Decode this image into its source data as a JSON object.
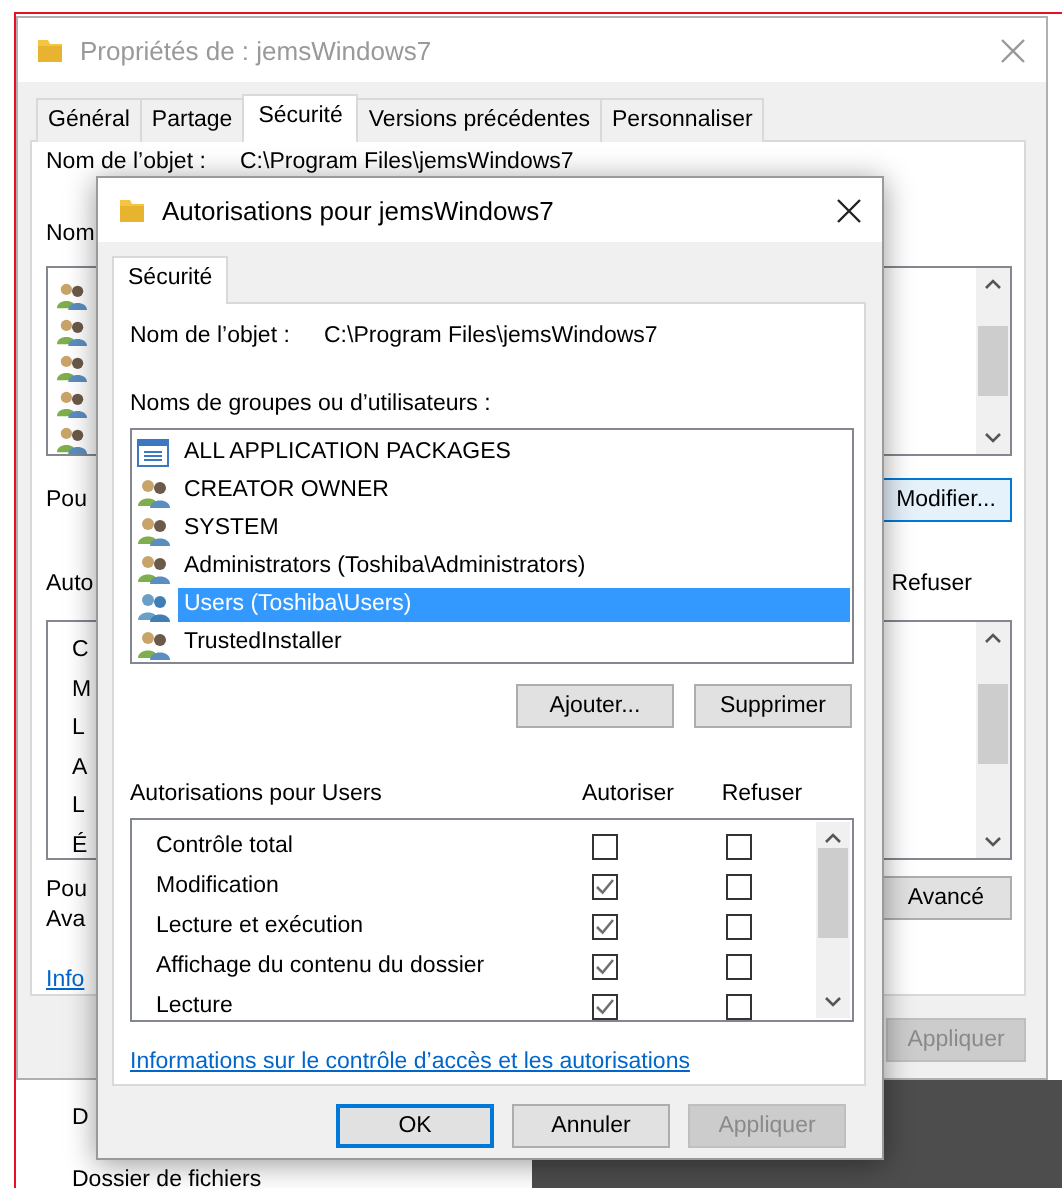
{
  "properties_window": {
    "title": "Propriétés de : jemsWindows7",
    "tabs": [
      {
        "label": "Général",
        "selected": false
      },
      {
        "label": "Partage",
        "selected": false
      },
      {
        "label": "Sécurité",
        "selected": true
      },
      {
        "label": "Versions précédentes",
        "selected": false
      },
      {
        "label": "Personnaliser",
        "selected": false
      }
    ],
    "object_label": "Nom de l’objet :",
    "object_path": "C:\\Program Files\\jemsWindows7",
    "groups_label": "Nom",
    "edit_note": "Pou",
    "modify_button": "Modifier...",
    "permissions_label": "Auto",
    "deny_header": "Refuser",
    "permission_fragments": [
      "C",
      "M",
      "L",
      "A",
      "L",
      "É"
    ],
    "advanced_note": [
      "Pou",
      "Ava"
    ],
    "advanced_button": "Avancé",
    "info_link": "Info",
    "apply_button": {
      "label": "Appliquer",
      "disabled": true
    }
  },
  "desktop_fragments": [
    "D",
    "Dossier de fichiers"
  ],
  "dialog": {
    "title": "Autorisations pour jemsWindows7",
    "tab": {
      "label": "Sécurité",
      "selected": true
    },
    "object_label": "Nom de l’objet :",
    "object_path": "C:\\Program Files\\jemsWindows7",
    "groups_label": "Noms de groupes ou d’utilisateurs :",
    "groups": [
      {
        "name": "ALL APPLICATION PACKAGES",
        "kind": "package",
        "selected": false
      },
      {
        "name": "CREATOR OWNER",
        "kind": "group",
        "selected": false
      },
      {
        "name": "SYSTEM",
        "kind": "group",
        "selected": false
      },
      {
        "name": "Administrators (Toshiba\\Administrators)",
        "kind": "group",
        "selected": false
      },
      {
        "name": "Users (Toshiba\\Users)",
        "kind": "users",
        "selected": true
      },
      {
        "name": "TrustedInstaller",
        "kind": "group",
        "selected": false
      }
    ],
    "buttons": [
      "Ajouter...",
      "Supprimer"
    ],
    "permissions_title": "Autorisations pour Users",
    "columns": [
      "Autoriser",
      "Refuser"
    ],
    "permissions": [
      {
        "name": "Contrôle total",
        "allow": false,
        "deny": false
      },
      {
        "name": "Modification",
        "allow": true,
        "deny": false
      },
      {
        "name": "Lecture et exécution",
        "allow": true,
        "deny": false
      },
      {
        "name": "Affichage du contenu du dossier",
        "allow": true,
        "deny": false
      },
      {
        "name": "Lecture",
        "allow": true,
        "deny": false
      }
    ],
    "link": "Informations sur le contrôle d’accès et les autorisations",
    "footer_buttons": [
      {
        "label": "OK",
        "default": true,
        "disabled": false
      },
      {
        "label": "Annuler",
        "default": false,
        "disabled": false
      },
      {
        "label": "Appliquer",
        "default": false,
        "disabled": true
      }
    ]
  }
}
